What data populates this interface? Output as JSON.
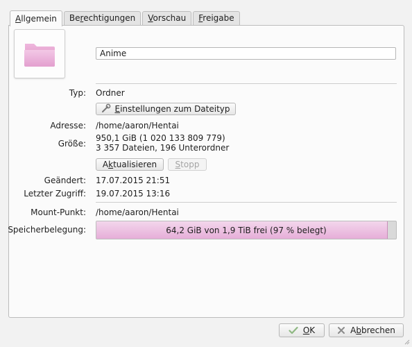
{
  "tabs": [
    {
      "label_mnemonic": "A",
      "label_rest": "llgemein",
      "active": true
    },
    {
      "label_pre": "Be",
      "label_mnemonic": "r",
      "label_rest": "echtigungen",
      "active": false
    },
    {
      "label_mnemonic": "V",
      "label_rest": "orschau",
      "active": false
    },
    {
      "label_mnemonic": "F",
      "label_rest": "reigabe",
      "active": false
    }
  ],
  "general": {
    "folder_icon": "pink-folder-icon",
    "name": "Anime",
    "type_label": "Typ:",
    "type_value": "Ordner",
    "filetype_button_pre": "E",
    "filetype_button_rest": "instellungen zum Dateityp",
    "address_label": "Adresse:",
    "address_value": "/home/aaron/Hentai",
    "size_label": "Größe:",
    "size_value": "950,1 GiB (1 020 133 809 779)",
    "size_detail": "3 357 Dateien, 196 Unterordner",
    "refresh_pre": "A",
    "refresh_mnemonic": "k",
    "refresh_rest": "tualisieren",
    "stop_pre": "",
    "stop_mnemonic": "S",
    "stop_rest": "topp",
    "modified_label": "Geändert:",
    "modified_value": "17.07.2015 21:51",
    "accessed_label": "Letzter Zugriff:",
    "accessed_value": "19.07.2015 13:16",
    "mount_label": "Mount-Punkt:",
    "mount_value": "/home/aaron/Hentai",
    "storage_label": "Speicherbelegung:",
    "storage_text": "64,2 GiB von 1,9 TiB frei (97 % belegt)",
    "storage_used_fraction": 0.97
  },
  "footer": {
    "ok_mnemonic": "O",
    "ok_rest": "K",
    "cancel_pre": "A",
    "cancel_mnemonic": "b",
    "cancel_rest": "brechen"
  },
  "colors": {
    "accent": "#e6aed8",
    "folder": "#e7a3cf",
    "ok_check": "#5b9a4e",
    "cancel_x": "#8a8a8a"
  }
}
